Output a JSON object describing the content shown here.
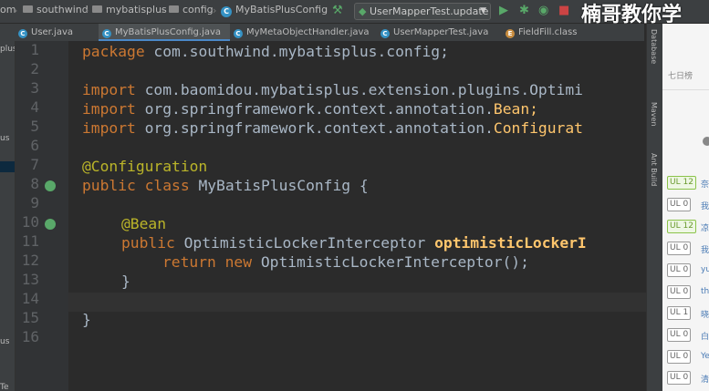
{
  "navbar": {
    "crumbs": [
      "om",
      "southwind",
      "mybatisplus",
      "config",
      "MyBatisPlusConfig"
    ],
    "run_config": "UserMapperTest.update",
    "watermark": "楠哥教你学"
  },
  "tabs": [
    {
      "label": "User.java"
    },
    {
      "label": "MyBatisPlusConfig.java"
    },
    {
      "label": "MyMetaObjectHandler.java"
    },
    {
      "label": "UserMapperTest.java"
    },
    {
      "label": "FieldFill.class"
    }
  ],
  "left_panel": {
    "items": [
      "plus",
      "us",
      "us",
      "Te"
    ]
  },
  "editor": {
    "line_numbers": [
      "1",
      "2",
      "3",
      "4",
      "5",
      "6",
      "7",
      "8",
      "9",
      "10",
      "11",
      "12",
      "13",
      "14",
      "15",
      "16"
    ],
    "code": {
      "l1_kw": "package",
      "l1_rest": " com.southwind.mybatisplus.config;",
      "l3_kw": "import",
      "l3_rest": " com.baomidou.mybatisplus.extension.plugins.Optimi",
      "l4_kw": "import",
      "l4_rest": " org.springframework.context.annotation.",
      "l4_hl": "Bean;",
      "l5_kw": "import",
      "l5_rest": " org.springframework.context.annotation.",
      "l5_hl": "Configurat",
      "l7_an": "@Configuration",
      "l8_kw": "public class",
      "l8_rest": " MyBatisPlusConfig {",
      "l10_an": "@Bean",
      "l11_kw": "public",
      "l11_rest": " OptimisticLockerInterceptor ",
      "l11_fn": "optimisticLockerI",
      "l12_kw": "return new",
      "l12_rest": " OptimisticLockerInterceptor();",
      "l13": "}",
      "l15": "}"
    }
  },
  "right_tools": [
    "Database",
    "Maven",
    "Ant Build"
  ],
  "right_panel": {
    "header": "七日榜",
    "rows": [
      {
        "badge": "UL 12",
        "text": "奈",
        "green": true
      },
      {
        "badge": "UL 0",
        "text": "我",
        "green": false
      },
      {
        "badge": "UL 12",
        "text": "凉",
        "green": true
      },
      {
        "badge": "UL 0",
        "text": "我",
        "green": false
      },
      {
        "badge": "UL 0",
        "text": "yu",
        "green": false
      },
      {
        "badge": "UL 0",
        "text": "th",
        "green": false
      },
      {
        "badge": "UL 1",
        "text": "晓",
        "green": false
      },
      {
        "badge": "UL 0",
        "text": "白",
        "green": false
      },
      {
        "badge": "UL 0",
        "text": "Ye",
        "green": false
      },
      {
        "badge": "UL 0",
        "text": "清",
        "green": false
      }
    ]
  },
  "colors": {
    "keyword": "#cc7832",
    "annotation": "#bbb529",
    "method": "#ffc66d",
    "text": "#a9b7c6"
  }
}
